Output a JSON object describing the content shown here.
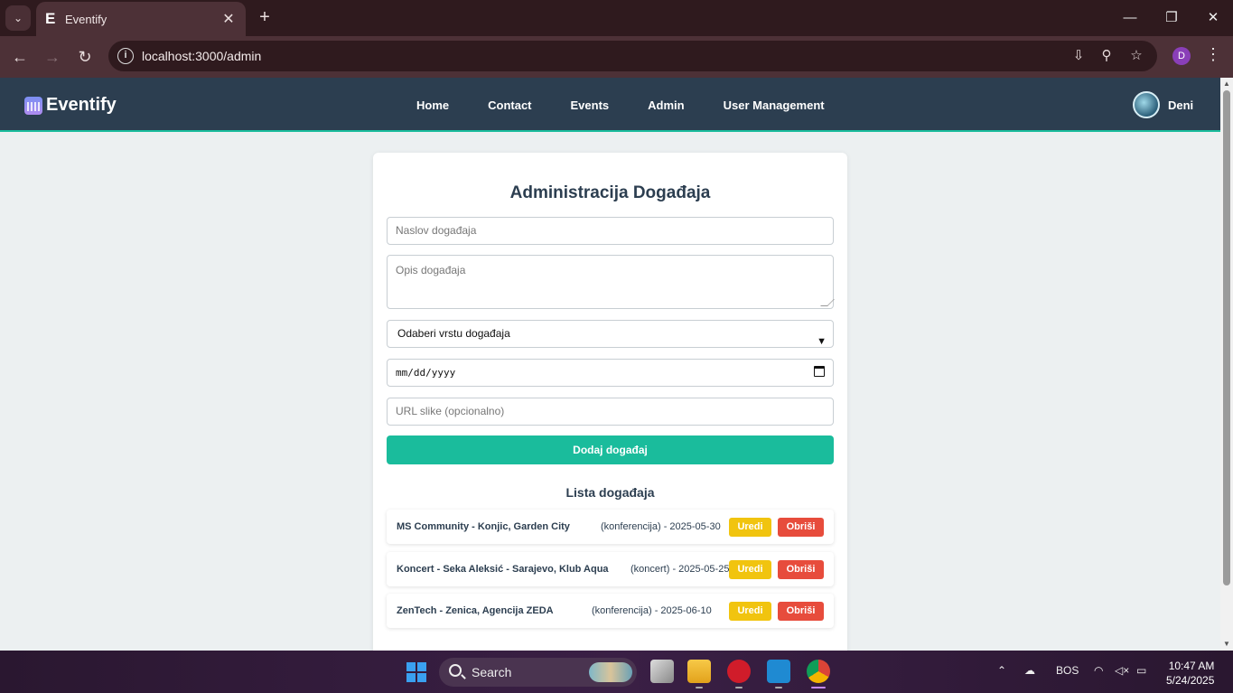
{
  "browser": {
    "tab_title": "Eventify",
    "tab_favicon": "E",
    "url": "localhost:3000/admin",
    "profile_initial": "D"
  },
  "navbar": {
    "brand": "Eventify",
    "menu": [
      "Home",
      "Contact",
      "Events",
      "Admin",
      "User Management"
    ],
    "user_name": "Deni"
  },
  "form": {
    "title": "Administracija Događaja",
    "title_placeholder": "Naslov događaja",
    "description_placeholder": "Opis događaja",
    "type_select": "Odaberi vrstu događaja",
    "date_placeholder": "mm/dd/yyyy",
    "image_url_placeholder": "URL slike (opcionalno)",
    "submit_label": "Dodaj događaj"
  },
  "list": {
    "title": "Lista događaja",
    "edit_label": "Uredi",
    "delete_label": "Obriši",
    "events": [
      {
        "title": "MS Community - Konjic, Garden City",
        "meta": "(konferencija) - 2025-05-30"
      },
      {
        "title": "Koncert - Seka Aleksić - Sarajevo, Klub Aqua",
        "meta": "(koncert) - 2025-05-25"
      },
      {
        "title": "ZenTech - Zenica, Agencija ZEDA",
        "meta": "(konferencija) - 2025-06-10"
      }
    ]
  },
  "taskbar": {
    "search_label": "Search",
    "language": "BOS",
    "time": "10:47 AM",
    "date": "5/24/2025"
  },
  "colors": {
    "navbar": "#2c3e50",
    "accent": "#1abc9c",
    "edit": "#f1c40f",
    "delete": "#e74c3c"
  }
}
